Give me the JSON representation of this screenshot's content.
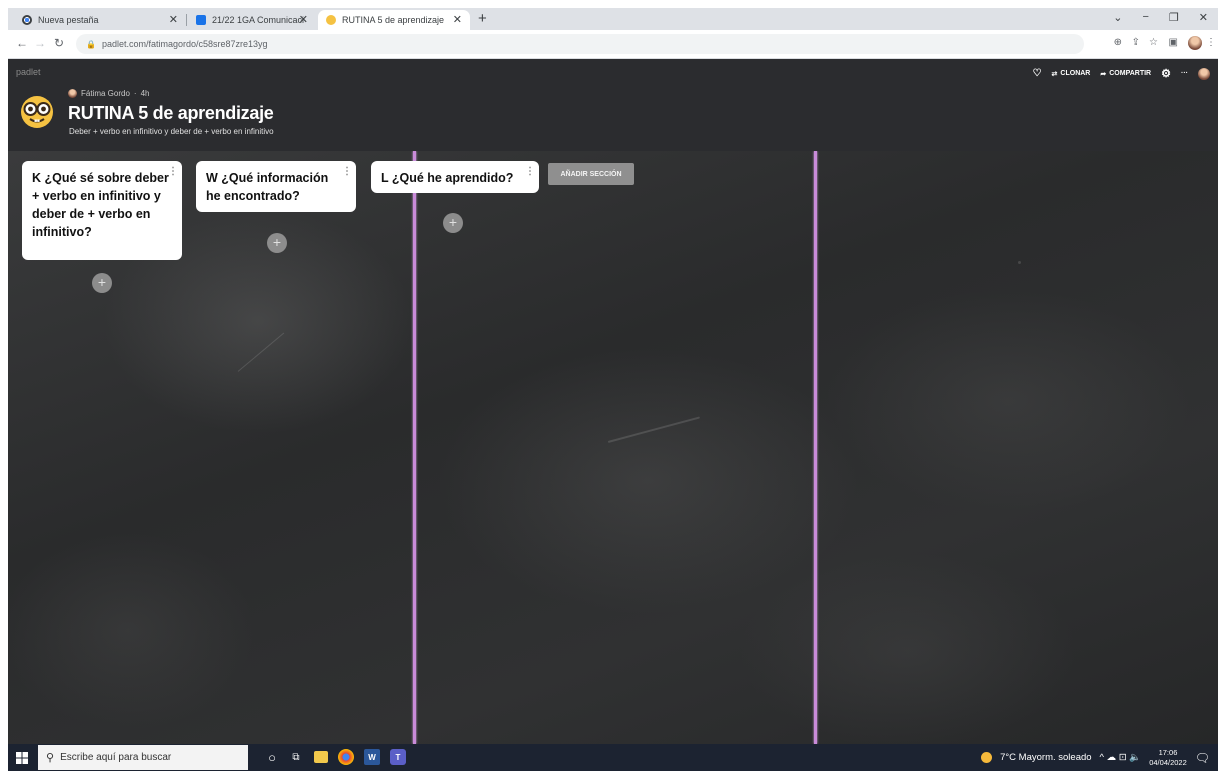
{
  "browser": {
    "tabs": [
      {
        "label": "Nueva pestaña",
        "icon": "chrome-icon"
      },
      {
        "label": "21/22 1GA Comunicación 1º GA",
        "icon": "classroom-icon"
      },
      {
        "label": "RUTINA 5 de aprendizaje",
        "icon": "padlet-emoji-icon",
        "active": true
      }
    ],
    "new_tab": "+",
    "url": "padlet.com/fatimagordo/c58sre87zre13yg",
    "window_controls": [
      "⌄",
      "−",
      "❐",
      "✕"
    ]
  },
  "padlet": {
    "logo": "padlet",
    "actions": {
      "clone": "CLONAR",
      "share": "COMPARTIR",
      "more": "···"
    },
    "author": "Fátima Gordo",
    "time_ago": "4h",
    "title": "RUTINA 5 de aprendizaje",
    "description": "Deber + verbo en infinitivo y deber de + verbo en infinitivo",
    "columns": [
      {
        "title": "K ¿Qué sé sobre deber + verbo en infinitivo y deber de + verbo en infinitivo?"
      },
      {
        "title": "W ¿Qué información he encontrado?"
      },
      {
        "title": "L ¿Qué he aprendido?"
      }
    ],
    "add_section": "AÑADIR SECCIÓN",
    "add_post": "+",
    "colors": {
      "header": "#2b2c2f",
      "chalk_line": "#c98bd9",
      "card": "#ffffff"
    }
  },
  "taskbar": {
    "search_placeholder": "Escribe aquí para buscar",
    "weather": "7°C  Mayorm. soleado",
    "time": "17:06",
    "date": "04/04/2022",
    "tray_icons": "^ ☁ ⊡ 🔈"
  }
}
